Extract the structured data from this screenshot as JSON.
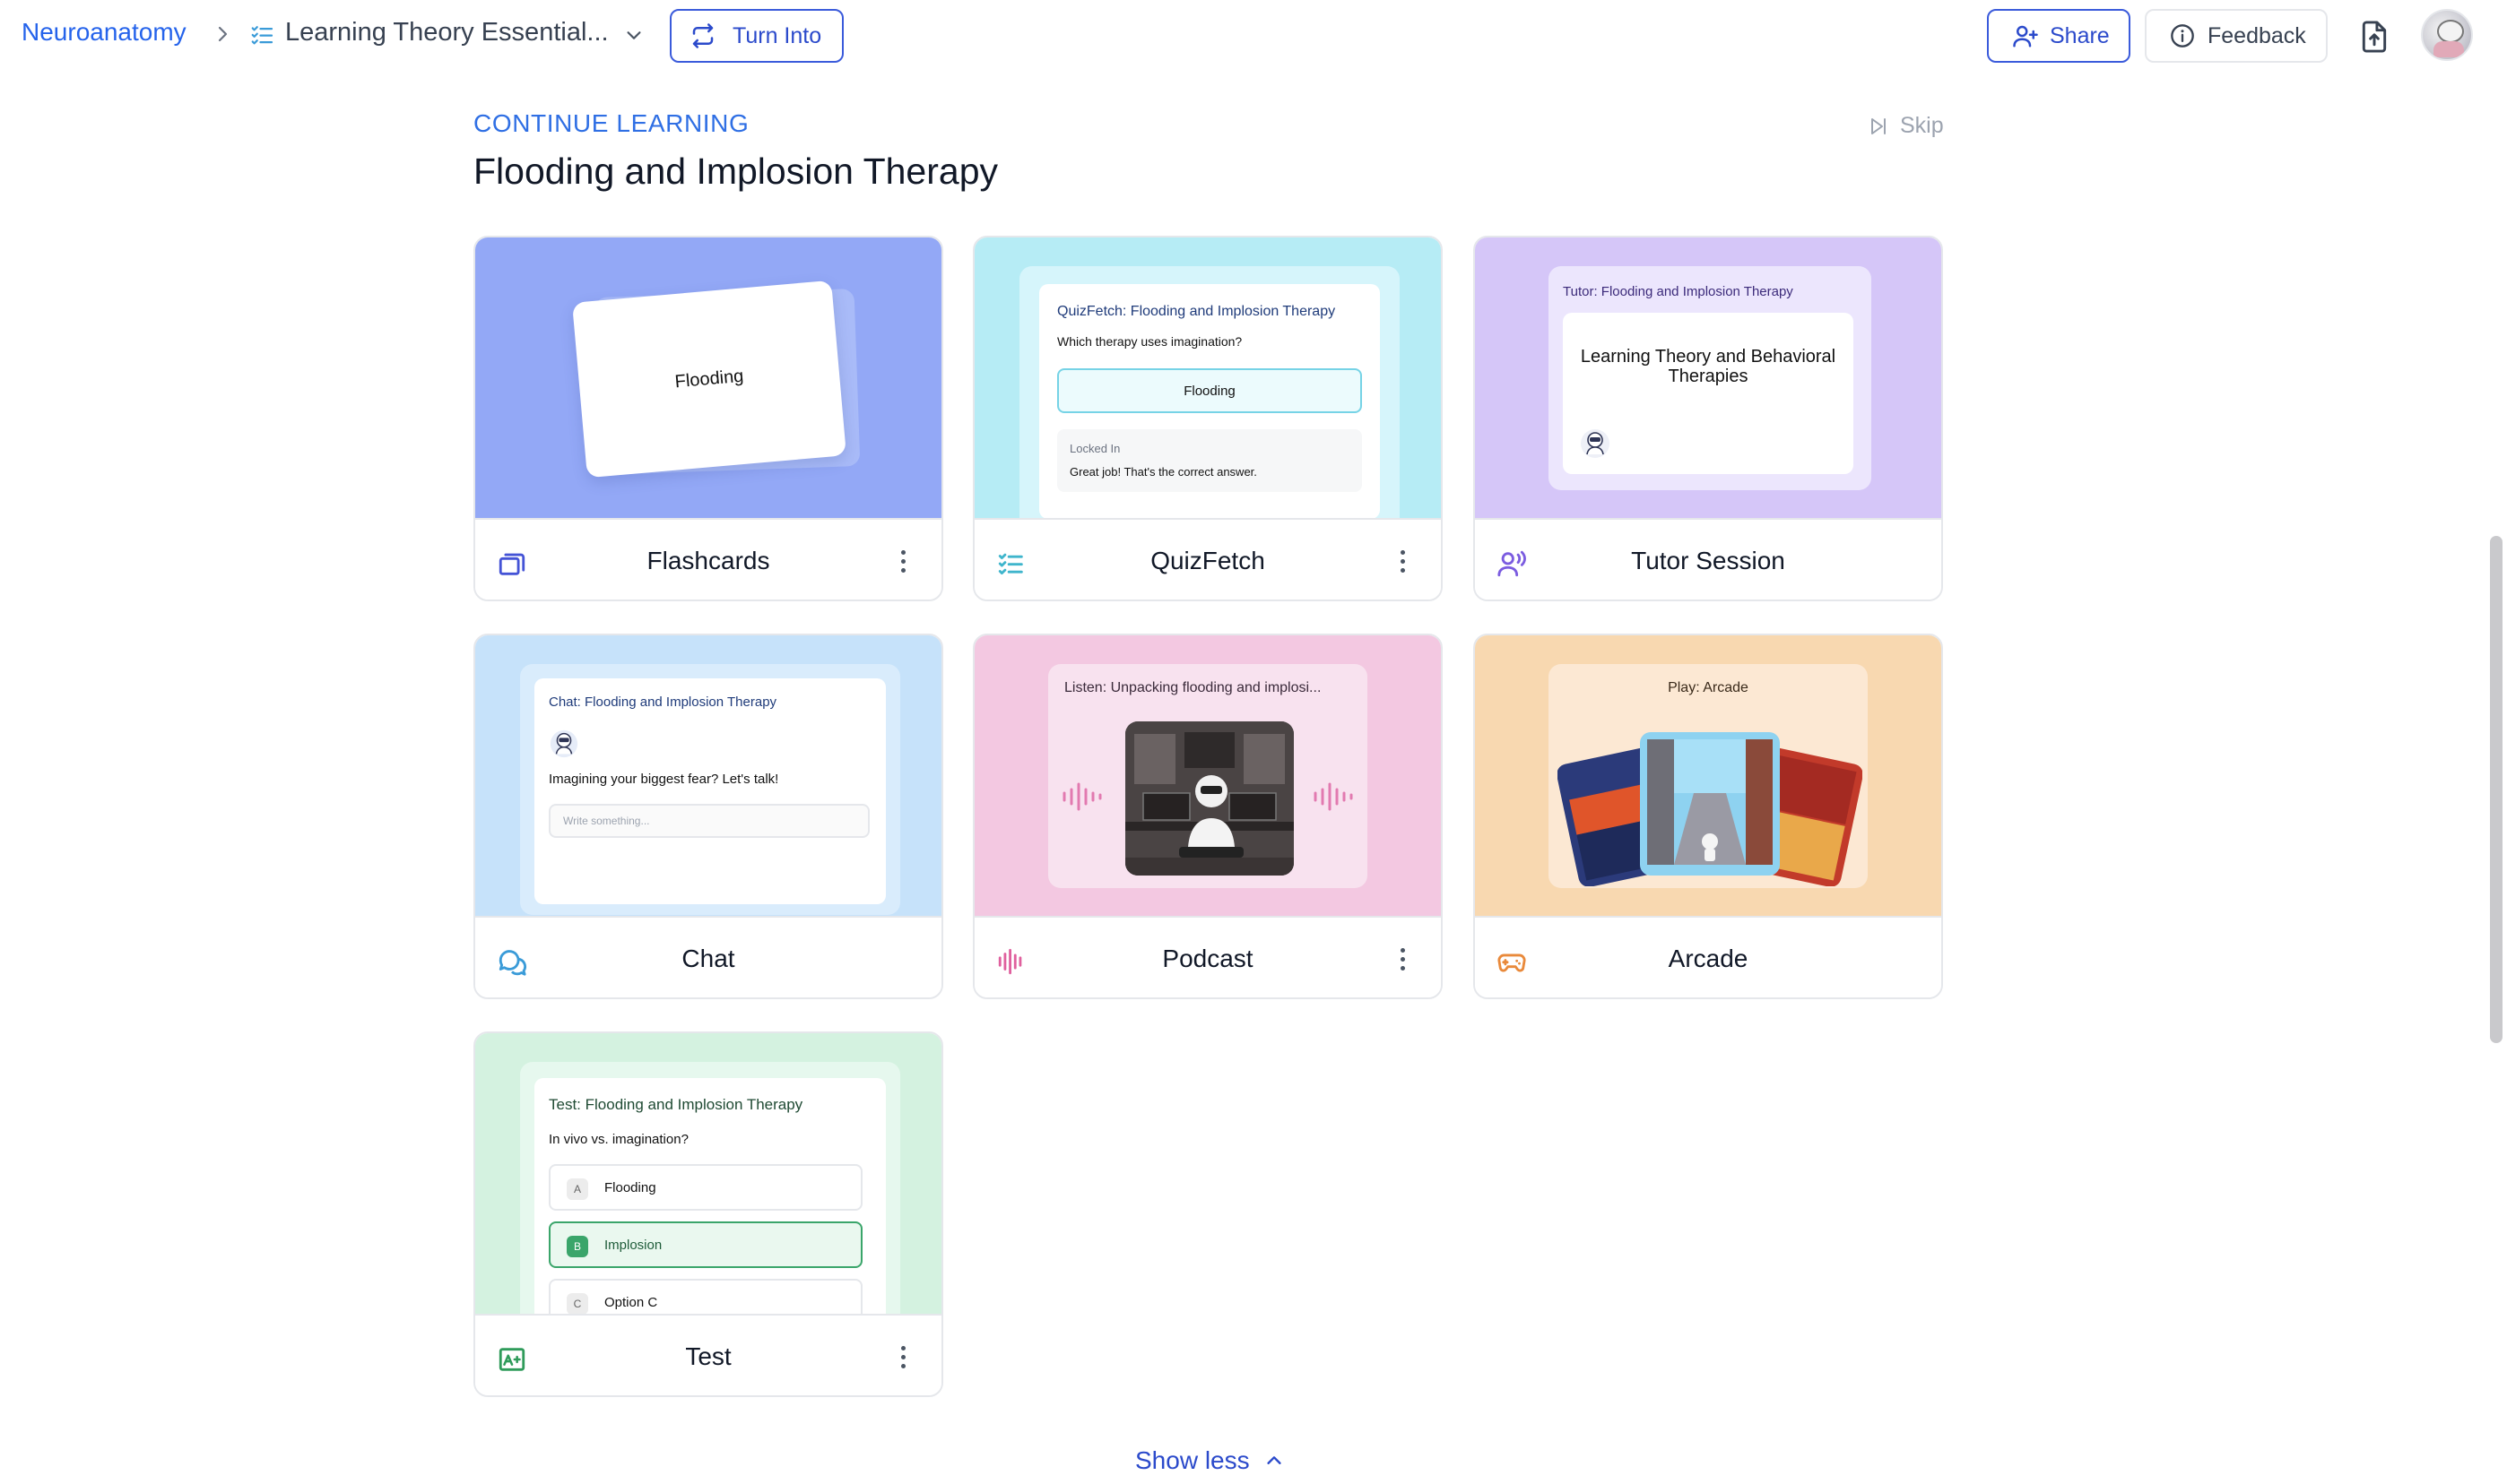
{
  "topbar": {
    "breadcrumb_root": "Neuroanatomy",
    "breadcrumb_doc": "Learning Theory Essential...",
    "turn_into_label": "Turn Into",
    "share_label": "Share",
    "feedback_label": "Feedback",
    "icons": [
      "chevron-right-icon",
      "checklist-icon",
      "chevron-down-icon",
      "convert-arrows-icon",
      "add-person-icon",
      "info-icon",
      "export-file-icon",
      "avatar"
    ]
  },
  "section": {
    "eyebrow": "CONTINUE LEARNING",
    "title": "Flooding and Implosion Therapy",
    "skip_label": "Skip"
  },
  "cards": [
    {
      "name": "Flashcards",
      "icon": "cards-stack-icon",
      "accent": "#4453d6",
      "preview": {
        "card_text": "Flooding"
      }
    },
    {
      "name": "QuizFetch",
      "icon": "checklist-icon",
      "accent": "#3fb5cc",
      "preview": {
        "title": "QuizFetch: Flooding and Implosion Therapy",
        "question": "Which therapy uses imagination?",
        "answer": "Flooding",
        "status": "Locked In",
        "feedback": "Great job! That's the correct answer."
      }
    },
    {
      "name": "Tutor Session",
      "icon": "voice-person-icon",
      "accent": "#7b5ce0",
      "preview": {
        "title": "Tutor: Flooding and Implosion Therapy",
        "text": "Learning Theory and Behavioral Therapies"
      }
    },
    {
      "name": "Chat",
      "icon": "chat-bubbles-icon",
      "accent": "#3a9bd8",
      "preview": {
        "title": "Chat: Flooding and Implosion Therapy",
        "message": "Imagining your biggest fear? Let's talk!",
        "input_placeholder": "Write something..."
      }
    },
    {
      "name": "Podcast",
      "icon": "sound-wave-icon",
      "accent": "#e0609e",
      "preview": {
        "title": "Listen: Unpacking flooding and implosi..."
      }
    },
    {
      "name": "Arcade",
      "icon": "gamepad-icon",
      "accent": "#e9893a",
      "preview": {
        "title": "Play: Arcade"
      }
    },
    {
      "name": "Test",
      "icon": "test-image-icon",
      "accent": "#2f9b5a",
      "preview": {
        "title": "Test: Flooding and Implosion Therapy",
        "question": "In vivo vs. imagination?",
        "options": [
          {
            "letter": "A",
            "text": "Flooding"
          },
          {
            "letter": "B",
            "text": "Implosion"
          },
          {
            "letter": "C",
            "text": "Option C"
          }
        ]
      }
    }
  ],
  "show_less_label": "Show less"
}
